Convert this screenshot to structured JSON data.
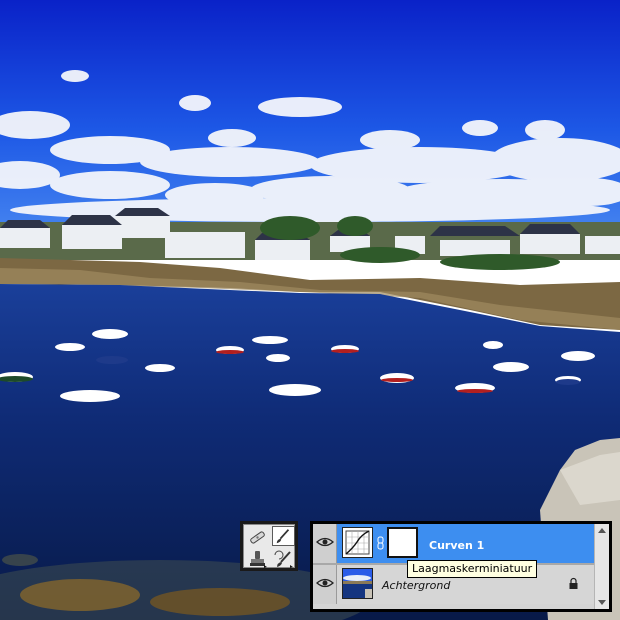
{
  "canvas": {
    "image": "harbor-photo",
    "colors": {
      "sky_top": "#0a2fd0",
      "sky_mid": "#2a6ff0",
      "water": "#0d2a70",
      "rocks": "#8a7348"
    }
  },
  "tool_palette": {
    "tools": [
      {
        "icon": "healing-brush-icon",
        "selected": false
      },
      {
        "icon": "brush-icon",
        "selected": true
      },
      {
        "icon": "clone-stamp-icon",
        "selected": false
      },
      {
        "icon": "history-brush-icon",
        "selected": false
      }
    ]
  },
  "layers_panel": {
    "layers": [
      {
        "name": "Curven 1",
        "selected": true,
        "visible": true,
        "type": "adjustment",
        "has_mask": true
      },
      {
        "name": "Achtergrond",
        "selected": false,
        "visible": true,
        "type": "background",
        "locked": true
      }
    ],
    "highlight_color": "#3d8ef0"
  },
  "tooltip": {
    "text": "Laagmaskerminiatuur"
  }
}
